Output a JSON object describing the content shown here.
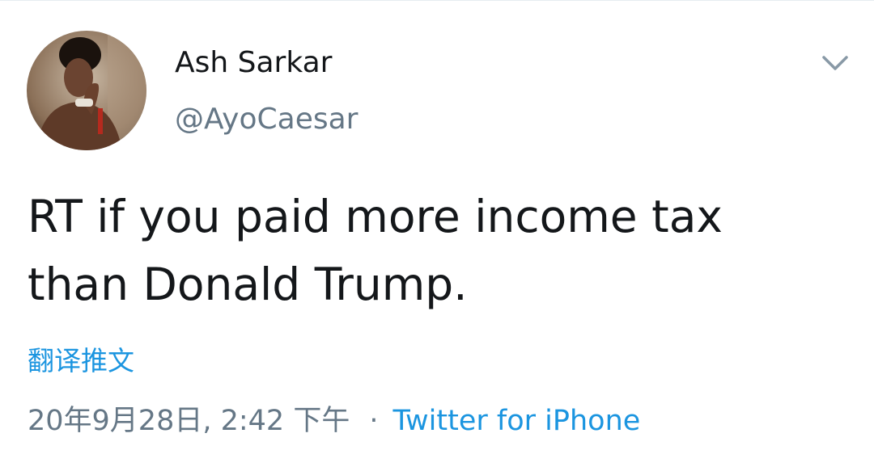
{
  "author": {
    "display_name": "Ash Sarkar",
    "handle": "@AyoCaesar",
    "avatar_icon": "profile-photo"
  },
  "menu": {
    "icon": "chevron-down-icon"
  },
  "tweet": {
    "text": "RT if you paid more income tax than Donald Trump.",
    "translate_label": "翻译推文",
    "timestamp": "20年9月28日, 2:42 下午",
    "separator": "·",
    "source": "Twitter for iPhone"
  },
  "colors": {
    "link": "#1b95e0",
    "secondary_text": "#657786",
    "primary_text": "#14171a"
  }
}
